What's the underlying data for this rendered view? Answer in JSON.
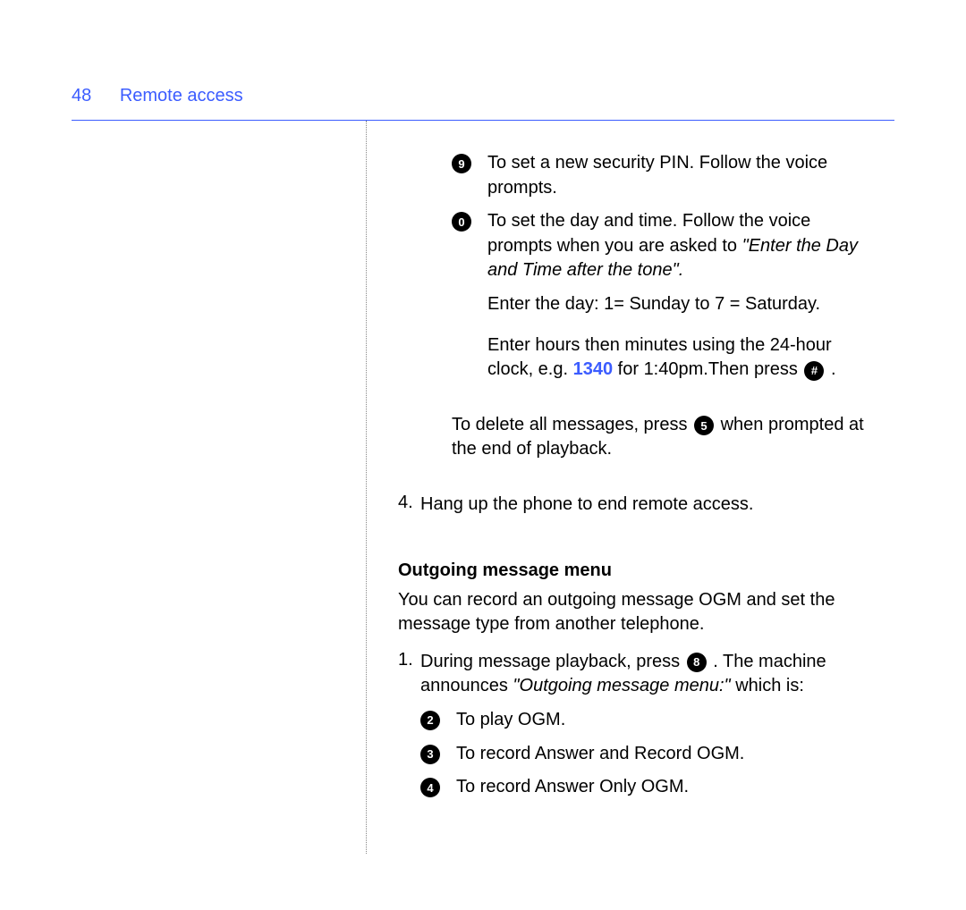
{
  "header": {
    "page_number": "48",
    "section_title": "Remote access"
  },
  "bullets_top": [
    {
      "icon": "9",
      "text": "To set a new security PIN. Follow the voice prompts."
    }
  ],
  "bullet0_prefix": "To set the day and time. Follow the voice prompts when you are asked to ",
  "bullet0_italic": "\"Enter the Day and Time after the tone\".",
  "after_bullet0": [
    "Enter the day: 1= Sunday to 7 = Saturday."
  ],
  "time_line_prefix": "Enter hours then minutes using the 24-hour clock, e.g. ",
  "time_code": "1340",
  "time_line_mid": " for 1:40pm.Then press ",
  "time_btn": "#",
  "time_line_suffix": " .",
  "delete_line_prefix": "To delete all messages, press ",
  "delete_btn": "5",
  "delete_line_suffix": " when prompted at the end of playback.",
  "step4_num": "4.",
  "step4_text": "Hang up the phone to end remote access.",
  "ogm_heading": "Outgoing message menu",
  "ogm_intro": "You can record an outgoing message OGM and set the message type from another telephone.",
  "ogm_step1_num": "1.",
  "ogm_step1_prefix": "During message playback, press ",
  "ogm_step1_btn": "8",
  "ogm_step1_mid": " . The machine announces ",
  "ogm_step1_italic": "\"Outgoing message menu:\"",
  "ogm_step1_suffix": " which is:",
  "ogm_options": [
    {
      "icon": "2",
      "text": "To play OGM."
    },
    {
      "icon": "3",
      "text": "To record Answer and Record OGM."
    },
    {
      "icon": "4",
      "text": "To record Answer Only OGM."
    }
  ]
}
